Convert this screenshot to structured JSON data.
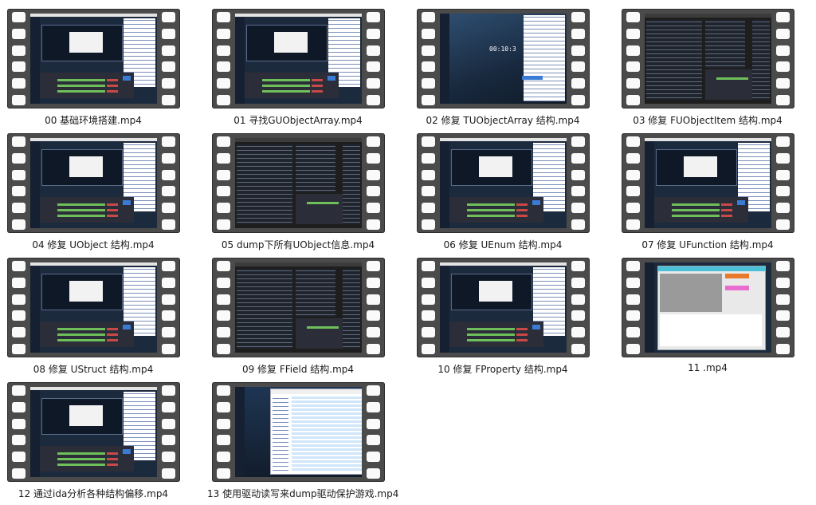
{
  "videos": [
    {
      "label": "00 基础环境搭建.mp4",
      "style": "obs"
    },
    {
      "label": "01 寻找GUObjectArray.mp4",
      "style": "obs"
    },
    {
      "label": "02 修复 TUObjectArray 结构.mp4",
      "style": "desktop",
      "overlay": "00:10:3"
    },
    {
      "label": "03 修复 FUObjectItem 结构.mp4",
      "style": "ide"
    },
    {
      "label": "04 修复 UObject 结构.mp4",
      "style": "obs"
    },
    {
      "label": "05 dump下所有UObject信息.mp4",
      "style": "ide"
    },
    {
      "label": "06 修复 UEnum 结构.mp4",
      "style": "obs"
    },
    {
      "label": "07 修复 UFunction 结构.mp4",
      "style": "obs"
    },
    {
      "label": "08 修复 UStruct 结构.mp4",
      "style": "obs"
    },
    {
      "label": "09 修复 FField 结构.mp4",
      "style": "ide"
    },
    {
      "label": "10 修复 FProperty 结构.mp4",
      "style": "obs"
    },
    {
      "label": "11 .mp4",
      "style": "app"
    },
    {
      "label": "12 通过ida分析各种结构偏移.mp4",
      "style": "obs"
    },
    {
      "label": "13 使用驱动读写来dump驱动保护游戏.mp4",
      "style": "explorer"
    }
  ],
  "colors": {
    "film": "#4b4b4b",
    "hole": "#fafafa",
    "desktop": "#1c2a3e",
    "obs_panel": "#2b2e38",
    "selection": "#3a7bd5",
    "pink_accent": "#e86fd0",
    "orange_accent": "#e8782a"
  }
}
